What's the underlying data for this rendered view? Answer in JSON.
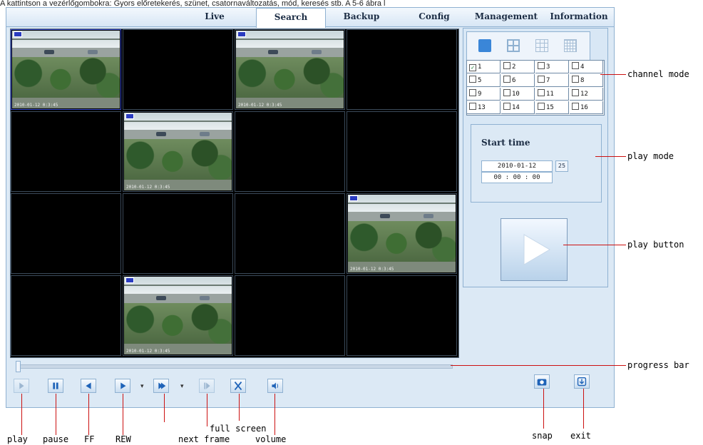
{
  "caption": "A kattintson a vezérlőgombokra: Gyors előretekerés, szünet, csatornaváltozatás, mód, keresés stb. A 5-6 ábra l",
  "tabs": [
    {
      "label": "Live"
    },
    {
      "label": "Search",
      "active": true
    },
    {
      "label": "Backup"
    },
    {
      "label": "Config"
    },
    {
      "label": "Management"
    },
    {
      "label": "Information"
    }
  ],
  "video_cells": [
    {
      "has_video": true,
      "timestamp": "2010-01-12 0:3:45",
      "selected": true
    },
    {
      "has_video": false
    },
    {
      "has_video": true,
      "timestamp": "2010-01-12 0:3:45"
    },
    {
      "has_video": false
    },
    {
      "has_video": false
    },
    {
      "has_video": true,
      "timestamp": "2010-01-12 0:3:45"
    },
    {
      "has_video": false
    },
    {
      "has_video": false
    },
    {
      "has_video": false
    },
    {
      "has_video": false
    },
    {
      "has_video": false
    },
    {
      "has_video": true,
      "timestamp": "2010-01-12 0:3:45"
    },
    {
      "has_video": false
    },
    {
      "has_video": true,
      "timestamp": "2010-01-12 0:3:45"
    },
    {
      "has_video": false
    },
    {
      "has_video": false
    }
  ],
  "channel_modes": [
    "single-view-icon",
    "quad-view-icon",
    "nine-view-icon",
    "sixteen-view-icon"
  ],
  "channels": [
    {
      "n": "1",
      "checked": true
    },
    {
      "n": "2"
    },
    {
      "n": "3"
    },
    {
      "n": "4"
    },
    {
      "n": "5"
    },
    {
      "n": "6"
    },
    {
      "n": "7"
    },
    {
      "n": "8"
    },
    {
      "n": "9"
    },
    {
      "n": "10"
    },
    {
      "n": "11"
    },
    {
      "n": "12"
    },
    {
      "n": "13"
    },
    {
      "n": "14"
    },
    {
      "n": "15"
    },
    {
      "n": "16"
    }
  ],
  "play_mode": {
    "title": "Start time",
    "date": "2010-01-12",
    "time": "00 : 00 : 00",
    "calendar_label": "25"
  },
  "progress": {
    "value": 0
  },
  "controls": {
    "play": "play-icon",
    "pause": "pause-icon",
    "ff": "rewind-icon",
    "rew": "fast-forward-icon",
    "step": "step-forward-icon",
    "next_frame": "next-frame-icon",
    "full_screen": "fullscreen-icon",
    "volume": "volume-icon",
    "snap": "camera-icon",
    "exit": "exit-icon"
  },
  "annotations": {
    "channel_mode": "channel mode",
    "play_mode": "play mode",
    "play_button": "play button",
    "progress_bar": "progress bar",
    "play": "play",
    "pause": "pause",
    "ff": "FF",
    "rew": "REW",
    "next_frame": "next frame",
    "full_screen": "full screen",
    "volume": "volume",
    "snap": "snap",
    "exit": "exit"
  },
  "colors": {
    "accent": "#3a86d8",
    "annotation_line": "#cc1111",
    "panel_bg": "#dce9f5"
  }
}
